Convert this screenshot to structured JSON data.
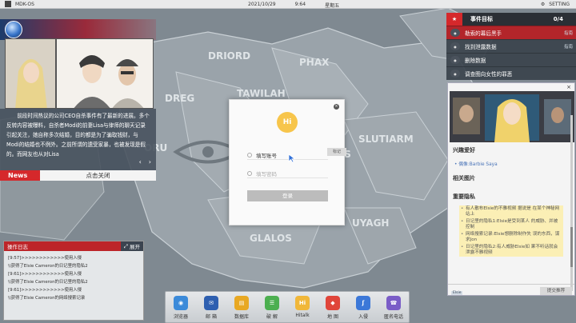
{
  "topbar": {
    "os_name": "MDK-OS",
    "date": "2021/10/29",
    "time": "9:64",
    "weekday": "星期五",
    "setting_label": "SETTING"
  },
  "news": {
    "body": "前段时间热议的公司CEO自杀事件有了最新的进展。多个反转内容被曝料，自杀者Modi的前妻Lisa与律师的聊天记录引起关注，她自称多次结婚，目的都是为了骗取钱财，与Modi的结婚也不例外。之前所谓的遗受家暴，也被发现是假的。而网友也从对Lisa",
    "tag": "News",
    "close_label": "点击关闭",
    "prev": "‹",
    "next": "›"
  },
  "oplog": {
    "title": "操作日志",
    "expand": "展开",
    "entries": [
      "[9:57]>>>>>>>>>>>>使用入侵",
      "\\\\获得了Elsie Cameron的日记里的隐私2",
      "[9:61]>>>>>>>>>>>>使用入侵",
      "\\\\获得了Elsie Cameron的日记里的隐私2",
      "[9:61]>>>>>>>>>>>>使用入侵",
      "\\\\获得了Elsie Cameron的网络搜索记录"
    ]
  },
  "events": {
    "title": "事件目标",
    "count": "0/4",
    "items": [
      {
        "label": "勒索的幕后黑手",
        "hint": "指南"
      },
      {
        "label": "找到泄露数据",
        "hint": "指南"
      },
      {
        "label": "删除数据",
        "hint": ""
      },
      {
        "label": "调查图向女性的罪恶",
        "hint": ""
      }
    ]
  },
  "profile": {
    "close": "×",
    "hobbies_title": "兴趣爱好",
    "hobby": "• 偶像:Barbie Saya",
    "related_title": "相关图片",
    "secrets_title": "重要隐私",
    "secrets": [
      "有人散布Elsie的不雅视频 据说是 在某个神秘网站上",
      "日记里的隐私1:Elsie是受到某人 的威胁、并被控制",
      "网络搜索记录:Elsie想删除制作失 误的东西，谋求Jon",
      "日记里的隐私2:有人威胁Elsie如 果不听话就会泄露不雅视频"
    ],
    "tag": "Elsie",
    "button": "提交推荐"
  },
  "login": {
    "close": "×",
    "logo_text": "Hi",
    "account_placeholder": "填写账号",
    "password_placeholder": "填写密码",
    "submit": "登录",
    "hint_tag": "标记"
  },
  "map_labels": [
    "DRIORD",
    "PHAX",
    "TAWILAH",
    "DREG",
    "SLUTIARM",
    "OS",
    "ORU",
    "UYAGH",
    "GLALOS"
  ],
  "dock": [
    {
      "label": "浏览器",
      "icon": "◉",
      "color": "#3b8ad9"
    },
    {
      "label": "邮 箱",
      "icon": "✉",
      "color": "#2e5fb0"
    },
    {
      "label": "数据库",
      "icon": "▤",
      "color": "#e8a823"
    },
    {
      "label": "破 解",
      "icon": "☰",
      "color": "#4caf50"
    },
    {
      "label": "Hitalk",
      "icon": "Hi",
      "color": "#f0b73a"
    },
    {
      "label": "地 图",
      "icon": "◆",
      "color": "#e0453a"
    },
    {
      "label": "入侵",
      "icon": "ʃ",
      "color": "#3c78d8"
    },
    {
      "label": "匿名电话",
      "icon": "☎",
      "color": "#7a5dc7"
    }
  ],
  "colors": {
    "accent_red": "#d5282b",
    "panel_dark": "#2b2f35",
    "map_bg": "#8c959b",
    "land": "#9aa3aa"
  }
}
